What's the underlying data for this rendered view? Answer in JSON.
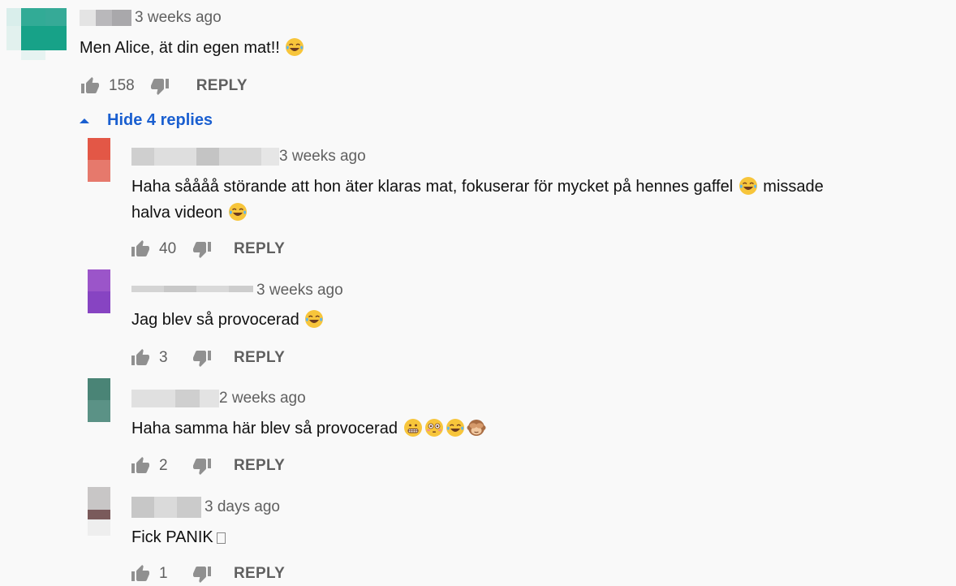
{
  "top_comment": {
    "timestamp": "3 weeks ago",
    "text": "Men Alice, ät din egen mat!!",
    "likes": "158",
    "reply_label": "REPLY"
  },
  "replies_toggle": {
    "label": "Hide 4 replies"
  },
  "replies": [
    {
      "timestamp": "3 weeks ago",
      "text_line1": "Haha såååå störande att hon äter klaras mat, fokuserar för mycket på hennes gaffel",
      "text_line1_end": "missade",
      "text_line2": "halva videon",
      "likes": "40",
      "reply_label": "REPLY"
    },
    {
      "timestamp": "3 weeks ago",
      "text": "Jag blev så provocerad",
      "likes": "3",
      "reply_label": "REPLY"
    },
    {
      "timestamp": "2 weeks ago",
      "text": "Haha samma här blev så provocerad",
      "likes": "2",
      "reply_label": "REPLY"
    },
    {
      "timestamp": "3 days ago",
      "text": "Fick PANIK",
      "likes": "1",
      "reply_label": "REPLY"
    }
  ],
  "icons": {
    "like": "thumb-up-icon",
    "dislike": "thumb-down-icon",
    "expand": "caret-up-icon",
    "emoji_laugh": "face-with-tears-of-joy-icon",
    "emoji_grimace": "grimacing-face-icon",
    "emoji_flushed": "flushed-face-icon",
    "emoji_monkey": "see-no-evil-monkey-icon"
  },
  "colors": {
    "background": "#f9f9f9",
    "link_blue": "#1a5fd0",
    "secondary_text": "#606060",
    "icon": "#909090"
  }
}
